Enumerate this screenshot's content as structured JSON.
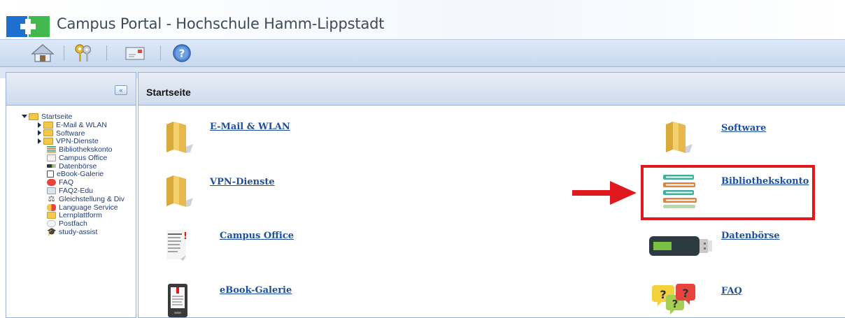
{
  "window": {
    "title": "Campus Portal - Hochschule Hamm-Lippstadt"
  },
  "toolbar": {
    "buttons": [
      {
        "name": "home",
        "icon": "home-icon"
      },
      {
        "name": "keys",
        "icon": "keys-icon"
      },
      {
        "name": "mail",
        "icon": "mail-icon"
      },
      {
        "name": "help",
        "icon": "help-icon"
      }
    ]
  },
  "sidebar": {
    "collapse_icon": "collapse-left-icon",
    "tree": [
      {
        "label": "Startseite",
        "level": 0,
        "expander": "expanded",
        "icon": "folder-icon"
      },
      {
        "label": "E-Mail & WLAN",
        "level": 1,
        "expander": "collapsed",
        "icon": "folder-icon"
      },
      {
        "label": "Software",
        "level": 1,
        "expander": "collapsed",
        "icon": "folder-icon"
      },
      {
        "label": "VPN-Dienste",
        "level": 1,
        "expander": "collapsed",
        "icon": "folder-icon"
      },
      {
        "label": "Bibliothekskonto",
        "level": 2,
        "icon": "books-icon"
      },
      {
        "label": "Campus Office",
        "level": 2,
        "icon": "document-icon"
      },
      {
        "label": "Datenbörse",
        "level": 2,
        "icon": "usb-stick-icon"
      },
      {
        "label": "eBook-Galerie",
        "level": 2,
        "icon": "ebook-icon"
      },
      {
        "label": "FAQ",
        "level": 2,
        "icon": "faq-icon"
      },
      {
        "label": "FAQ2-Edu",
        "level": 2,
        "icon": "faq2-icon"
      },
      {
        "label": "Gleichstellung & Div",
        "level": 2,
        "icon": "scales-icon"
      },
      {
        "label": "Language Service",
        "level": 2,
        "icon": "language-icon"
      },
      {
        "label": "Lernplattform",
        "level": 2,
        "icon": "learning-icon"
      },
      {
        "label": "Postfach",
        "level": 2,
        "icon": "postbox-icon"
      },
      {
        "label": "study-assist",
        "level": 2,
        "icon": "graduation-cap-icon"
      }
    ]
  },
  "main": {
    "title": "Startseite",
    "tiles": [
      {
        "label": "E-Mail & WLAN",
        "icon": "folder-icon"
      },
      {
        "label": "Software",
        "icon": "folder-icon"
      },
      {
        "label": "VPN-Dienste",
        "icon": "folder-icon"
      },
      {
        "label": "Bibliothekskonto",
        "icon": "books-icon"
      },
      {
        "label": "Campus Office",
        "icon": "document-icon"
      },
      {
        "label": "Datenbörse",
        "icon": "usb-stick-icon"
      },
      {
        "label": "eBook-Galerie",
        "icon": "ebook-icon"
      },
      {
        "label": "FAQ",
        "icon": "faq-icon"
      }
    ]
  },
  "annotation": {
    "highlight_color": "#e0191f",
    "target": "Bibliothekskonto"
  },
  "colors": {
    "link": "#1e4f9c",
    "toolbar": "#c7d8ef",
    "logo_blue": "#1f6fcf",
    "logo_green": "#41b94f"
  }
}
